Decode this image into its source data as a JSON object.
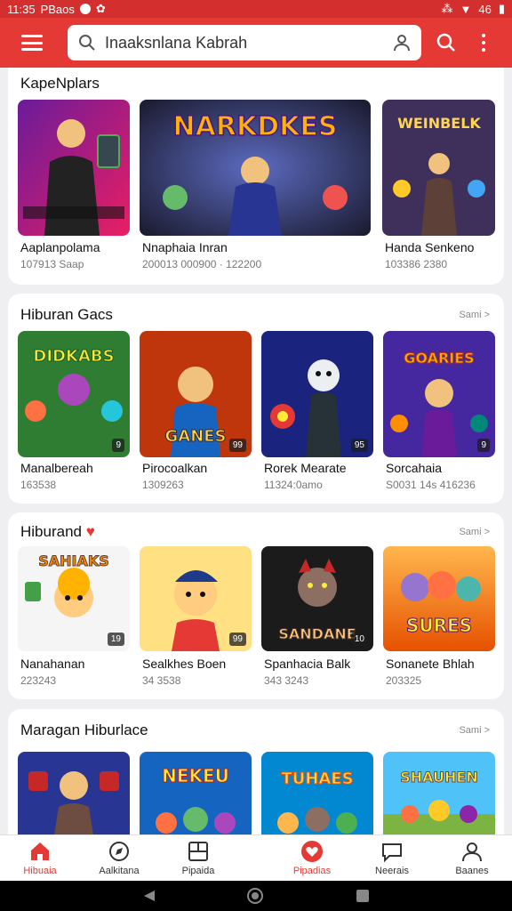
{
  "status": {
    "time": "11:35",
    "app": "PBaos",
    "right": "46"
  },
  "search": {
    "query": "Inaaksnlana Kabrah"
  },
  "sections": [
    {
      "title": "KapeNplars",
      "more": "",
      "items": [
        {
          "name": "Aaplanpolama",
          "sub": "107913 Saap",
          "badge": "",
          "art": "a"
        },
        {
          "name": "Nnaphaia Inran",
          "sub": "200013 000900 · 122200",
          "badge": "",
          "art": "b"
        },
        {
          "name": "Handa Senkeno",
          "sub": "103386 2380",
          "badge": "",
          "art": "c"
        }
      ]
    },
    {
      "title": "Hiburan Gacs",
      "more": "Sami >",
      "items": [
        {
          "name": "Manalbereah",
          "sub": "163538",
          "badge": "9",
          "art": "d"
        },
        {
          "name": "Pirocoalkan",
          "sub": "1309263",
          "badge": "99",
          "art": "e"
        },
        {
          "name": "Rorek Mearate",
          "sub": "11324:0amo",
          "badge": "95",
          "art": "f"
        },
        {
          "name": "Sorcahaia",
          "sub": "S0031 14s 416236",
          "badge": "9",
          "art": "g"
        }
      ]
    },
    {
      "title": "Hiburand",
      "more": "Sami >",
      "items": [
        {
          "name": "Nanahanan",
          "sub": "223243",
          "badge": "19",
          "art": "h"
        },
        {
          "name": "Sealkhes Boen",
          "sub": "34 3538",
          "badge": "99",
          "art": "i"
        },
        {
          "name": "Spanhacia Balk",
          "sub": "343 3243",
          "badge": "10",
          "art": "j"
        },
        {
          "name": "Sonanete Bhlah",
          "sub": "203325",
          "badge": "",
          "art": "k"
        }
      ]
    },
    {
      "title": "Maragan Hiburlace",
      "more": "Sami >",
      "items": [
        {
          "name": "",
          "sub": "",
          "badge": "",
          "art": "l"
        },
        {
          "name": "",
          "sub": "",
          "badge": "",
          "art": "m"
        },
        {
          "name": "",
          "sub": "",
          "badge": "",
          "art": "n"
        },
        {
          "name": "",
          "sub": "",
          "badge": "",
          "art": "o"
        }
      ]
    }
  ],
  "thumb_text": {
    "b": "NARKDKES",
    "c": "WEINBELK",
    "d": "DIDKABS",
    "e": "GANES",
    "g": "GOARIES",
    "h": "SAHIAKS",
    "j": "SANDANE",
    "k": "SURES",
    "m": "NEKEU",
    "n": "TUHAES",
    "o": "SHAUHEN"
  },
  "nav": [
    {
      "label": "Hibuaia",
      "icon": "home-icon",
      "active": true
    },
    {
      "label": "Aalkitana",
      "icon": "explore-icon",
      "active": false
    },
    {
      "label": "Pipaida",
      "icon": "tablet-icon",
      "active": false
    },
    {
      "label": "Pipadias",
      "icon": "heart-icon",
      "active": true
    },
    {
      "label": "Neerais",
      "icon": "chat-icon",
      "active": false
    },
    {
      "label": "Baanes",
      "icon": "profile-icon",
      "active": false
    }
  ],
  "colors": {
    "accent": "#e53935",
    "status": "#d32f2f"
  }
}
